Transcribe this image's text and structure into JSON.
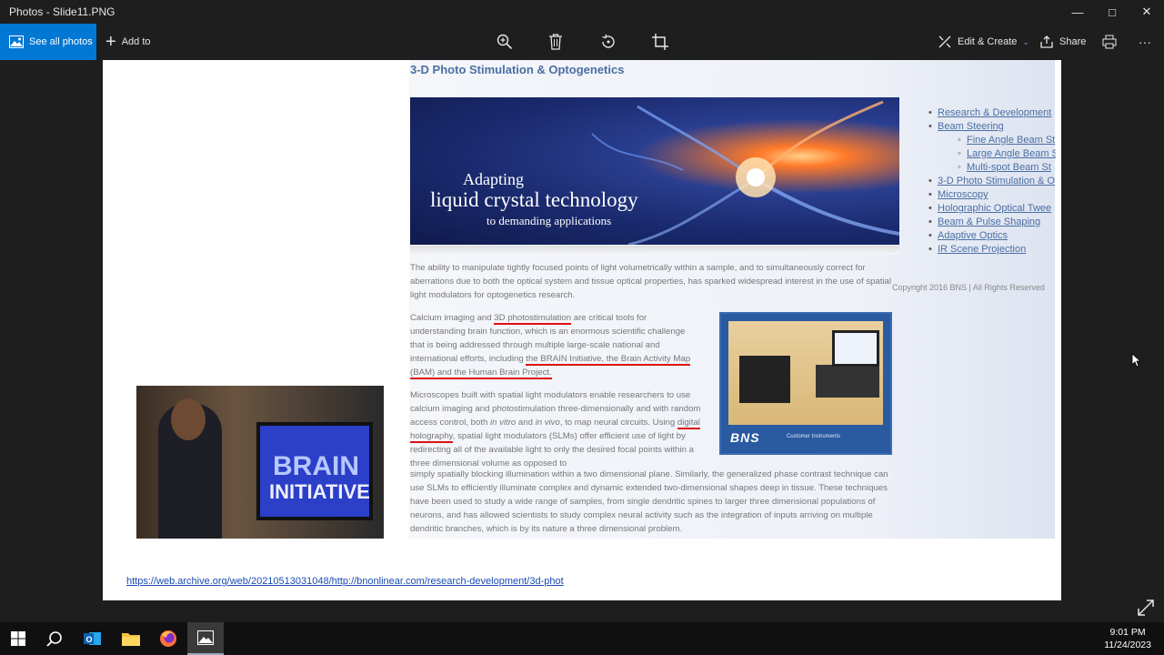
{
  "window": {
    "title": "Photos - Slide11.PNG",
    "minimize": "—",
    "maximize": "□",
    "close": "✕"
  },
  "toolbar": {
    "see_all_photos": "See all photos",
    "add_to": "Add to",
    "edit_create": "Edit & Create",
    "share": "Share",
    "more": "···"
  },
  "slide": {
    "page_title": "3-D Photo Stimulation & Optogenetics",
    "banner": {
      "line1": "Adapting",
      "line2": "liquid crystal technology",
      "line3": "to demanding applications"
    },
    "nav": [
      "Research & Development",
      "Beam Steering",
      "Fine Angle Beam St",
      "Large Angle Beam S",
      "Multi-spot Beam St",
      "3-D Photo Stimulation & O",
      "Microscopy",
      "Holographic Optical Twee",
      "Beam & Pulse Shaping",
      "Adaptive Optics",
      "IR Scene Projection"
    ],
    "copyright": "Copyright 2016 BNS | All Rights Reserved",
    "p1": "The ability to manipulate tightly focused points of light volumetrically within a sample, and to simultaneously correct for aberrations due to both the optical system and tissue optical properties, has sparked widespread interest in the use of spatial light modulators for optogenetics research.",
    "p2": {
      "a": "Calcium imaging and ",
      "u1": "3D photostimulation",
      "b": " are critical tools for understanding brain function, which is an enormous scientific challenge that is being addressed through multiple large-scale national and international efforts, including ",
      "u2": "the BRAIN Initiative, the Brain Activity Map (BAM) and the Human Brain Project."
    },
    "p3": {
      "a": "Microscopes built with spatial light modulators enable researchers to use calcium imaging and photostimulation three-dimensionally and with random access control, both ",
      "i1": "in vitro",
      "b": " and ",
      "i2": "in vivo",
      "c": ", to map neural circuits. Using ",
      "u1": "digital holography",
      "d": ", spatial light modulators (SLMs) offer efficient use of light by redirecting all of the available light to only the desired focal points within a three dimensional volume as opposed to"
    },
    "p4": "simply spatially blocking illumination within a two dimensional plane. Similarly, the generalized phase contrast technique can use SLMs to efficiently illuminate complex and dynamic extended two-dimensional shapes deep in tissue. These techniques have been used to study a wide range of samples, from single dendritic spines to larger three dimensional populations of neurons, and has allowed scientists to study complex neural activity such as the integration of inputs arriving on multiple dendritic branches, which is by its nature a three dimensional problem.",
    "device_logo": "BNS",
    "device_sub": "Customer Instruments",
    "brain_sign": {
      "line1": "BRAIN",
      "line2": "INITIATIVE"
    },
    "url": "https://web.archive.org/web/20210513031048/http://bnonlinear.com/research-development/3d-phot"
  },
  "taskbar": {
    "time": "9:01 PM",
    "date": "11/24/2023"
  },
  "colors": {
    "accent": "#0078d4",
    "link": "#4a6fa3",
    "underline": "#dd1111"
  }
}
